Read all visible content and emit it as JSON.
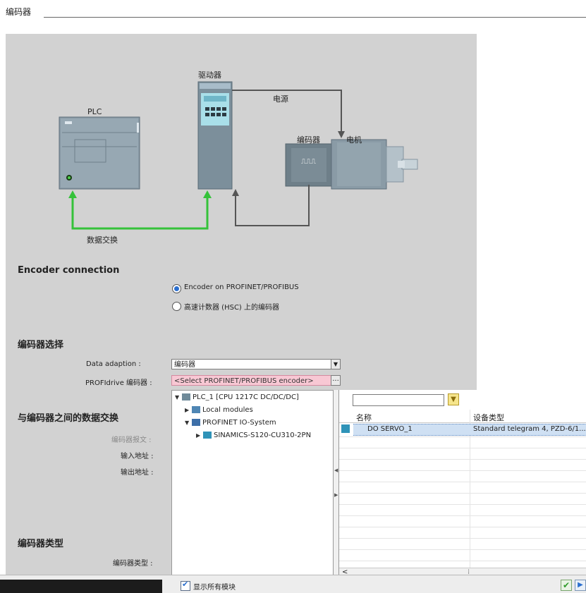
{
  "section": {
    "title": "编码器"
  },
  "diagram": {
    "plc_label": "PLC",
    "drive_label": "驱动器",
    "power_label": "电源",
    "encoder_label": "编码器",
    "motor_label": "电机",
    "data_exchange_label": "数据交换",
    "encoder_symbol": "⎍⎍⎍"
  },
  "encoder_connection": {
    "heading": "Encoder connection",
    "options": [
      {
        "label": "Encoder on PROFINET/PROFIBUS",
        "selected": true
      },
      {
        "label": "高速计数器 (HSC) 上的编码器",
        "selected": false
      }
    ]
  },
  "encoder_selection": {
    "heading": "编码器选择",
    "data_adaption_label": "Data adaption :",
    "data_adaption_value": "编码器",
    "profidrive_label": "PROFIdrive 编码器 :",
    "profidrive_value": "<Select PROFINET/PROFIBUS encoder>",
    "browse_label": "..."
  },
  "data_exchange": {
    "heading": "与编码器之间的数据交换",
    "telegram_label": "编码器报文 :",
    "input_label": "输入地址 :",
    "output_label": "输出地址 :"
  },
  "encoder_type": {
    "heading": "编码器类型",
    "type_label": "编码器类型 :"
  },
  "tree": {
    "items": [
      {
        "label": "PLC_1 [CPU 1217C DC/DC/DC]"
      },
      {
        "label": "Local modules"
      },
      {
        "label": "PROFINET IO-System"
      },
      {
        "label": "SINAMICS-S120-CU310-2PN"
      }
    ]
  },
  "table": {
    "filter_value": "",
    "col_name": "名称",
    "col_type": "设备类型",
    "rows": [
      {
        "name": "DO SERVO_1",
        "type": "Standard telegram 4, PZD-6/1..."
      }
    ]
  },
  "bottom": {
    "show_all_label": "显示所有模块"
  },
  "colors": {
    "panel_bg": "#d2d2d2",
    "accent_green": "#35c23a",
    "accent_blue": "#2b6fcf",
    "selection_pink": "#f8c8d4"
  }
}
